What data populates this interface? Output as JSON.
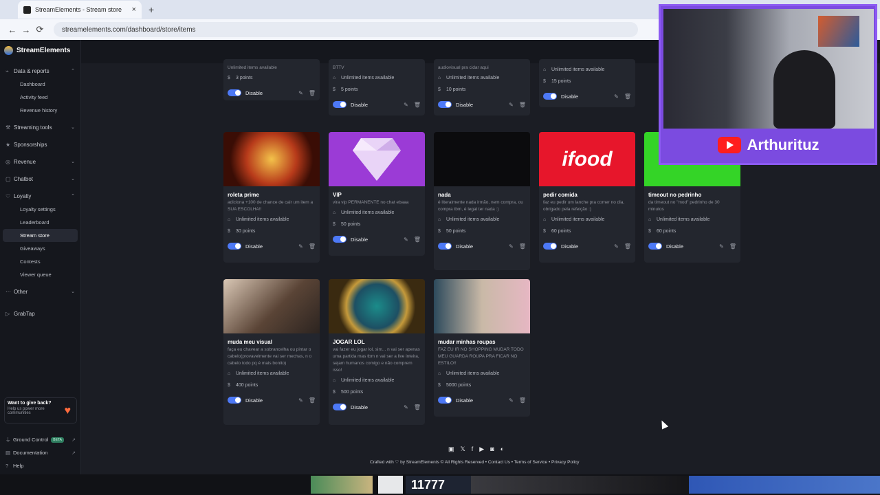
{
  "browser": {
    "tab_title": "StreamElements - Stream store",
    "url": "streamelements.com/dashboard/store/items"
  },
  "sidebar": {
    "brand": "StreamElements",
    "sections": [
      {
        "label": "Data & reports",
        "icon": "chart-icon",
        "items": [
          "Dashboard",
          "Activity feed",
          "Revenue history"
        ]
      },
      {
        "label": "Streaming tools",
        "icon": "tools-icon",
        "items": []
      },
      {
        "label": "Sponsorships",
        "icon": "star-icon",
        "items": []
      },
      {
        "label": "Revenue",
        "icon": "coin-icon",
        "items": []
      },
      {
        "label": "Chatbot",
        "icon": "chat-icon",
        "items": []
      },
      {
        "label": "Loyalty",
        "icon": "heart-icon",
        "items": [
          "Loyalty settings",
          "Leaderboard",
          "Stream store",
          "Giveaways",
          "Contests",
          "Viewer queue"
        ]
      },
      {
        "label": "Other",
        "icon": "dots-icon",
        "items": []
      },
      {
        "label": "GrabTap",
        "icon": "play-icon",
        "items": []
      }
    ],
    "active_item": "Stream store",
    "giveback_title": "Want to give back?",
    "giveback_sub": "Help us power more communities",
    "bottom": [
      {
        "label": "Ground Control",
        "badge": "BETA"
      },
      {
        "label": "Documentation"
      },
      {
        "label": "Help"
      }
    ]
  },
  "cards_top": [
    {
      "desc": "Unlimited items available",
      "availability": "",
      "price": "3 points"
    },
    {
      "desc": "BTTV",
      "availability": "Unlimited items available",
      "price": "5 points"
    },
    {
      "desc": "audiovisual pra cidar aqui",
      "availability": "Unlimited items available",
      "price": "10 points"
    },
    {
      "desc": "",
      "availability": "Unlimited items available",
      "price": "15 points"
    }
  ],
  "cards": [
    {
      "title": "roleta prime",
      "desc": "adiciona +100 de chance de cair um item a SUA ESCOLHA!!",
      "availability": "Unlimited items available",
      "price": "30 points"
    },
    {
      "title": "VIP",
      "desc": "vira vip PERMANENTE no chat ebaaa",
      "availability": "Unlimited items available",
      "price": "50 points"
    },
    {
      "title": "nada",
      "desc": "é literalmente nada irmão, nem compra, ou compra tbm, é legal ter nada :)",
      "availability": "Unlimited items available",
      "price": "50 points"
    },
    {
      "title": "pedir comida",
      "desc": "faz eu pedir um lanche pra comer no dia, obrigado pela refeição :)",
      "availability": "Unlimited items available",
      "price": "60 points"
    },
    {
      "title": "timeout no pedrinho",
      "desc": "da timeout no \"mod\" pedrinho de 30 minutos",
      "availability": "Unlimited items available",
      "price": "60 points"
    },
    {
      "title": "muda meu visual",
      "desc": "faça eu chavear a sobrancelha ou pintar o cabelo(provavelmente vai ser mechas, n o cabelo todo pq é mais bonito)",
      "availability": "Unlimited items available",
      "price": "400 points"
    },
    {
      "title": "JOGAR LOL",
      "desc": "vai fazer eu jogar lol, sim... n vai ser apenas uma partida mas tbm n vai ser a live inteira, sejam humanos comigo e não comprem isso!",
      "availability": "Unlimited items available",
      "price": "500 points"
    },
    {
      "title": "mudar minhas roupas",
      "desc": "FAZ EU IR NO SHOPPING MUDAR TODO MEU GUARDA ROUPA PRA FICAR NO ESTILO!!",
      "availability": "Unlimited items available",
      "price": "5000 points"
    }
  ],
  "card_labels": {
    "disable": "Disable"
  },
  "images": {
    "ifood_text": "ifood"
  },
  "footer": {
    "text": "Crafted with ♡ by StreamElements © All Rights Reserved • Contact Us • Terms of Service • Privacy Policy",
    "social": [
      "twitch-icon",
      "x-icon",
      "facebook-icon",
      "youtube-icon",
      "instagram-icon",
      "discord-icon"
    ]
  },
  "overlay": {
    "channel_name": "Arthurituz",
    "counter": "11777"
  },
  "colors": {
    "accent": "#4d79f6",
    "overlay_purple": "#7b4be0"
  }
}
